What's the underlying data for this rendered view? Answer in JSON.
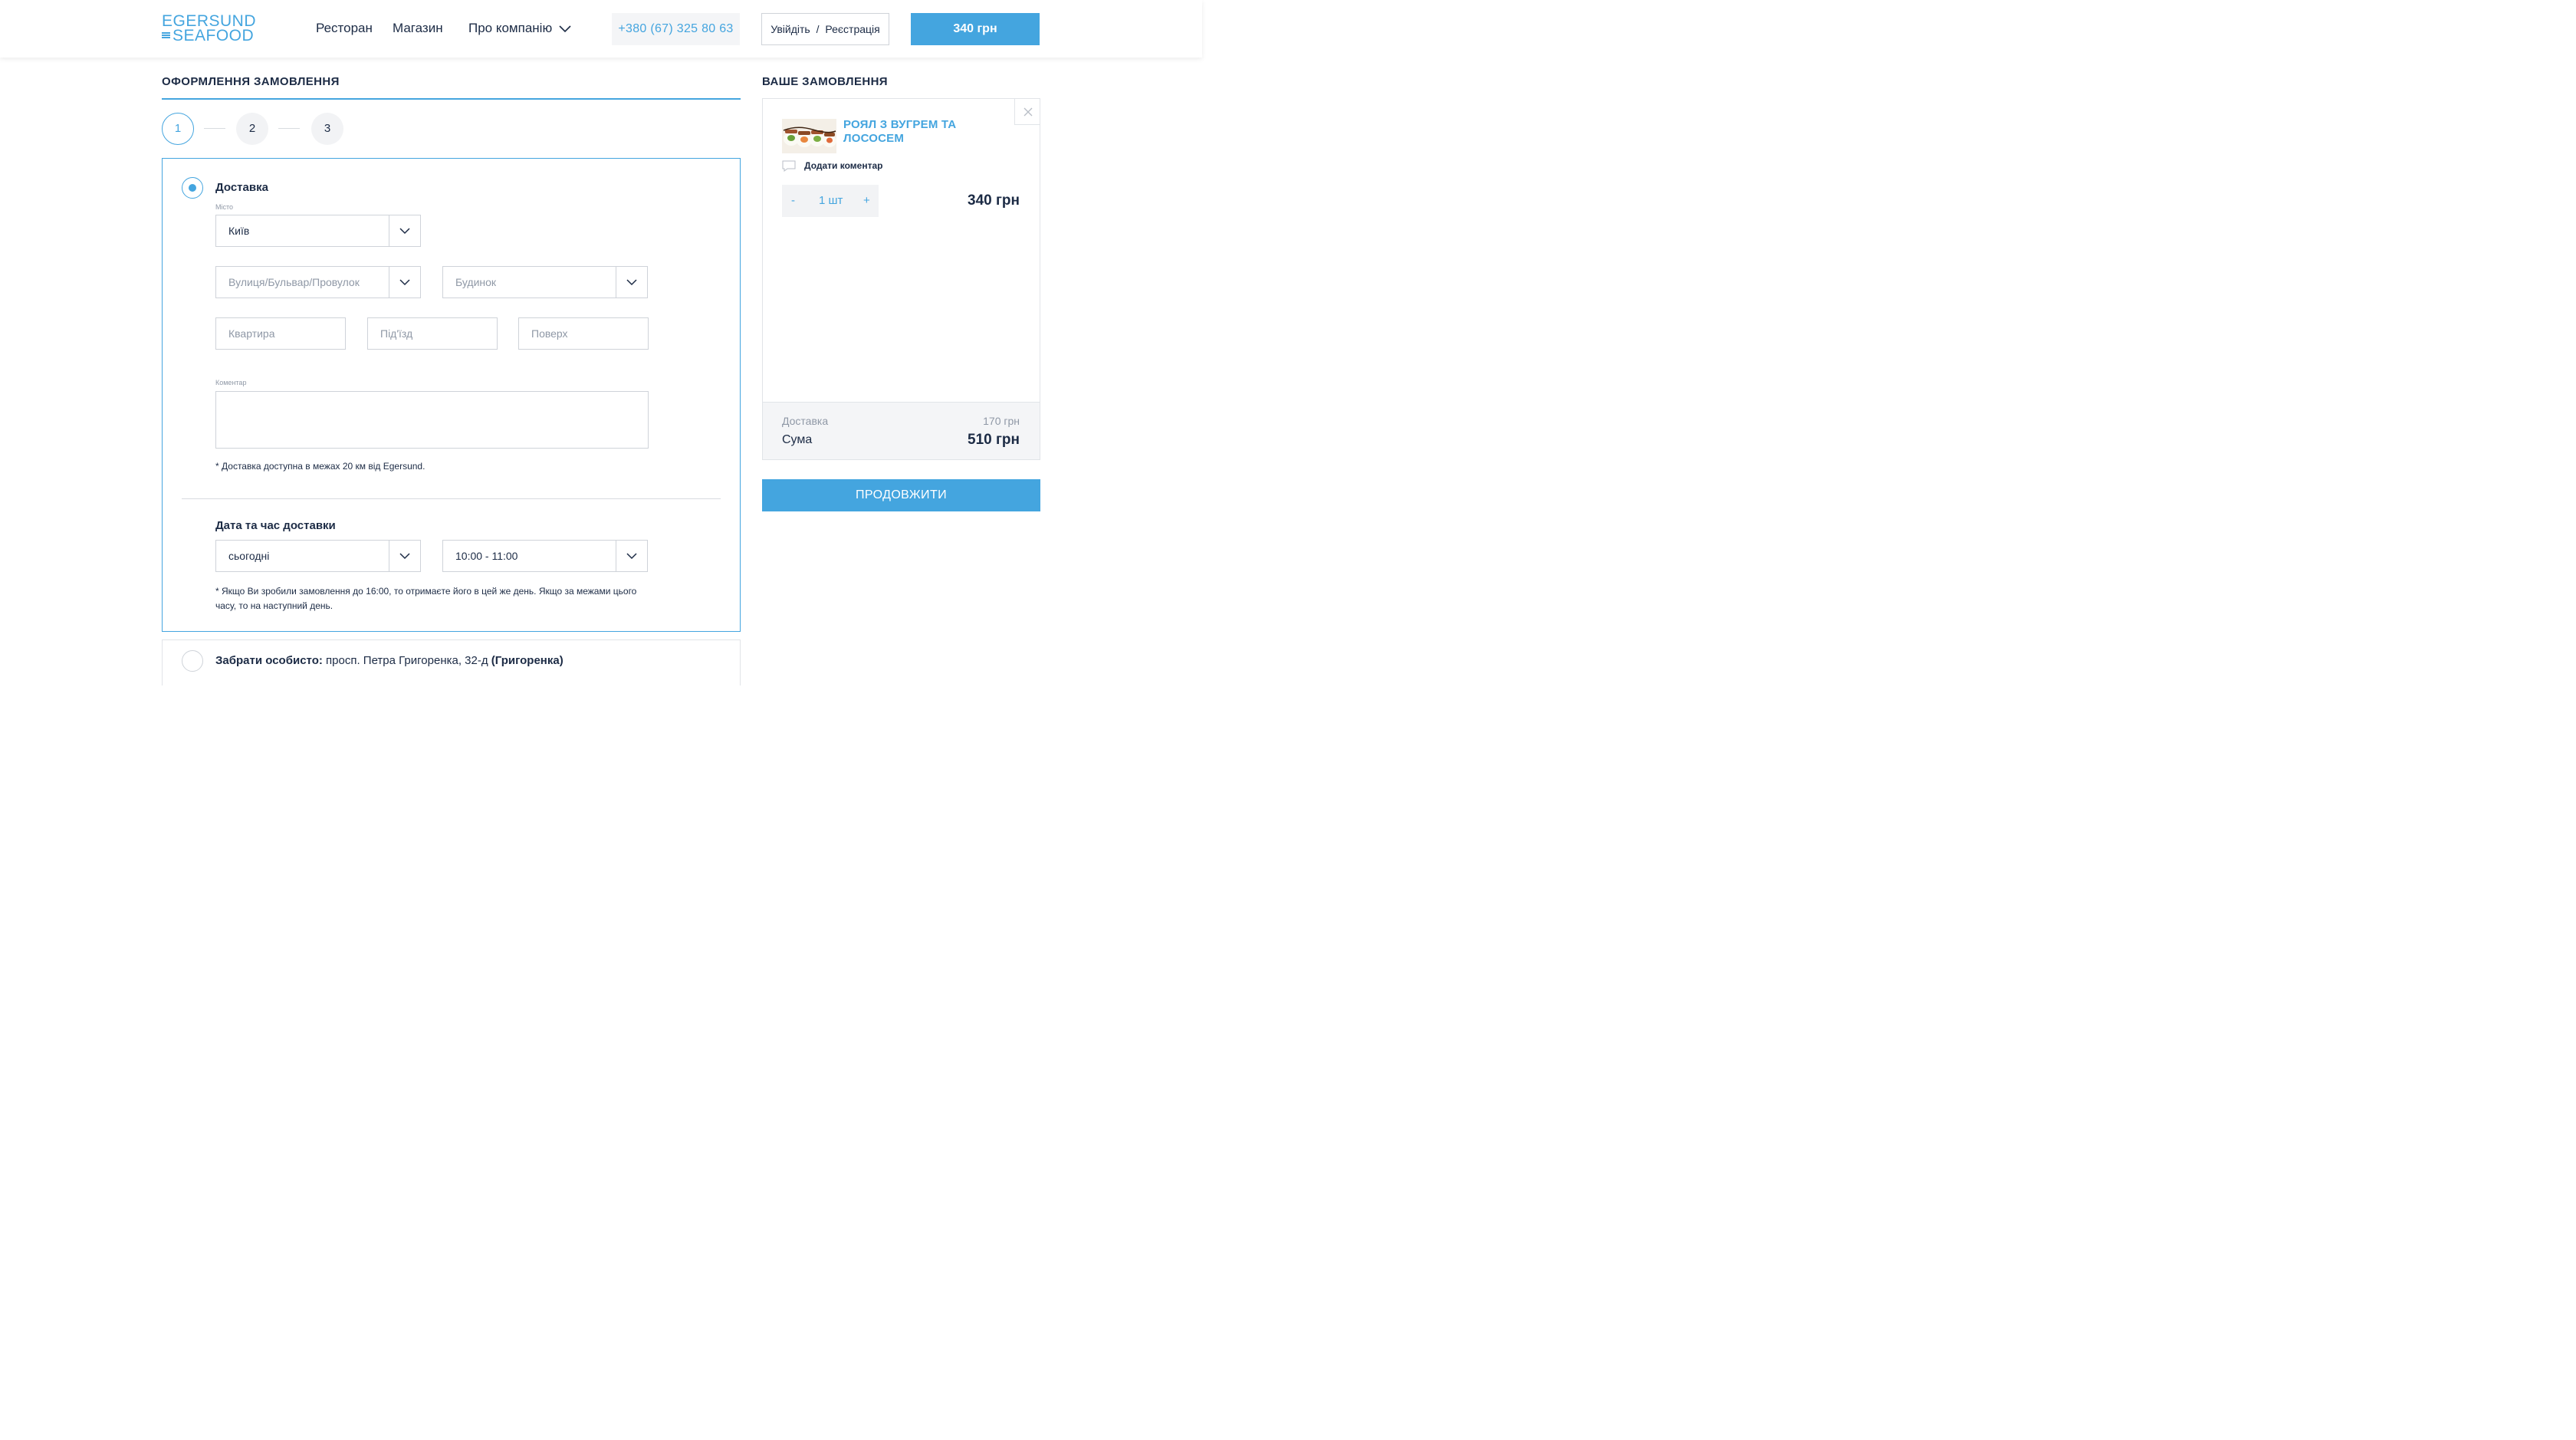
{
  "header": {
    "logo_top": "EGERSUND",
    "logo_bottom": "SEAFOOD",
    "nav": [
      "Ресторан",
      "Магазин",
      "Про компанію"
    ],
    "phone": "+380 (67) 325 80 63",
    "login": "Увійдіть",
    "login_sep": "/",
    "register": "Реєстрація",
    "cart_total": "340 грн"
  },
  "checkout": {
    "title": "ОФОРМЛЕННЯ ЗАМОВЛЕННЯ",
    "steps": [
      "1",
      "2",
      "3"
    ],
    "active_step": 1,
    "delivery": {
      "option_label": "Доставка",
      "city_label": "Місто",
      "city_value": "Київ",
      "street_placeholder": "Вулиця/Бульвар/Провулок",
      "house_placeholder": "Будинок",
      "apartment_placeholder": "Квартира",
      "entrance_placeholder": "Під'їзд",
      "floor_placeholder": "Поверх",
      "comment_label": "Коментар",
      "note": "* Доставка доступна в межах 20 км від Egersund."
    },
    "datetime": {
      "title": "Дата та час доставки",
      "date_value": "сьогодні",
      "time_value": "10:00 - 11:00",
      "note": "* Якщо Ви зробили замовлення до 16:00, то отримаєте його в цей же день. Якщо за межами цього часу, то на наступний день."
    },
    "pickup": {
      "label": "Забрати особисто:",
      "address": "просп. Петра Григоренка, 32-д",
      "branch": "(Григоренка)"
    }
  },
  "order": {
    "title": "ВАШЕ ЗАМОВЛЕННЯ",
    "item_name": "РОЯЛ З ВУГРЕМ ТА ЛОСОСЕМ",
    "add_comment": "Додати коментар",
    "qty_minus": "-",
    "qty_value": "1 шт",
    "qty_plus": "+",
    "item_price": "340 грн",
    "delivery_label": "Доставка",
    "delivery_price": "170 грн",
    "sum_label": "Сума",
    "sum_value": "510 грн",
    "continue": "ПРОДОВЖИТИ"
  },
  "colors": {
    "accent": "#44a5df",
    "text": "#1c2b45",
    "muted": "#8f98a6",
    "border": "#cfd3d9",
    "panel_bg": "#f4f5f7"
  },
  "icons": [
    "chevron-down-icon",
    "close-icon",
    "comment-icon",
    "logo-fish-icon"
  ]
}
